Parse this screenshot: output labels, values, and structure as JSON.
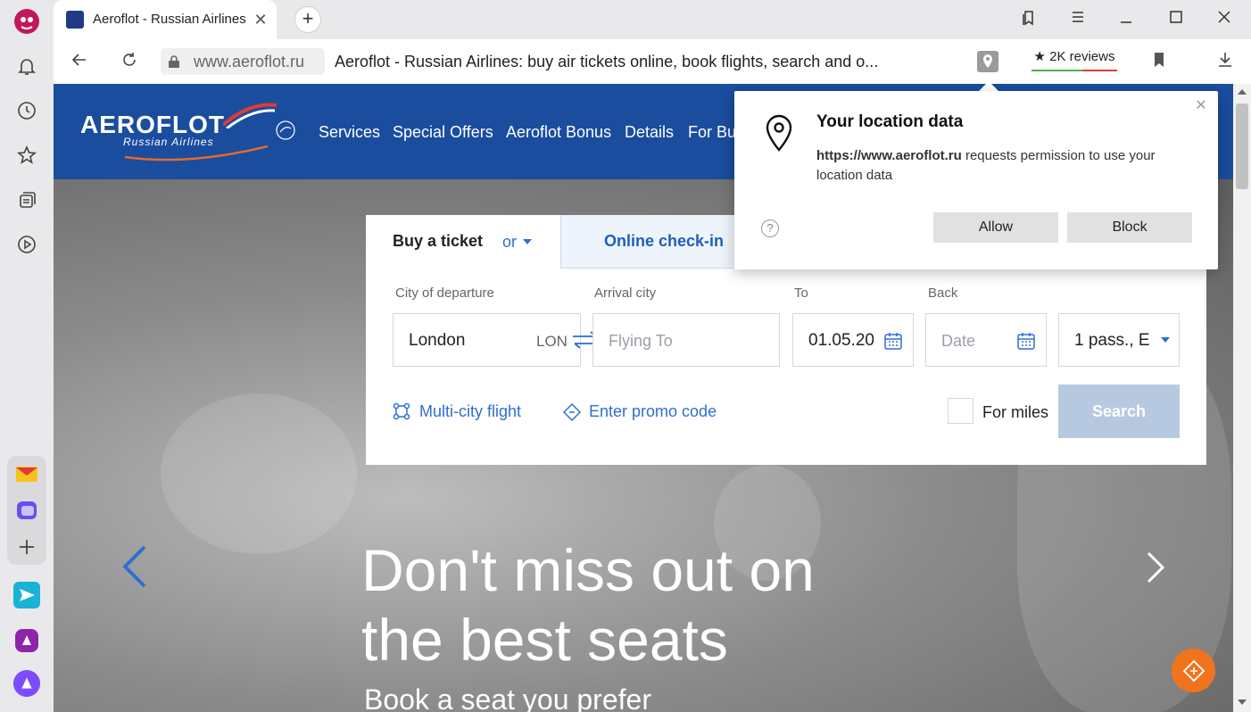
{
  "browser": {
    "tab": {
      "title": "Aeroflot - Russian Airlines",
      "close": "✕"
    },
    "new_tab": "+",
    "window_controls": [
      "bookmark-tabs-icon",
      "menu-icon",
      "minimize-icon",
      "maximize-icon",
      "close-icon"
    ],
    "address": {
      "domain": "www.aeroflot.ru",
      "page_title": "Aeroflot - Russian Airlines: buy air tickets online, book flights, search and o...",
      "reviews": "★ 2K reviews"
    },
    "sidebar_icons": [
      "notifications-icon",
      "history-icon",
      "favorites-icon",
      "collections-icon",
      "video-icon",
      "mail-icon",
      "messenger-icon",
      "add-icon",
      "send-icon",
      "app-icon",
      "alice-icon"
    ]
  },
  "site": {
    "logo": {
      "name": "AEROFLOT",
      "subtitle": "Russian Airlines"
    },
    "nav": [
      "Services",
      "Special Offers",
      "Aeroflot Bonus",
      "Details",
      "For Bu"
    ],
    "booking": {
      "tab_buy": "Buy a ticket",
      "tab_or": "or",
      "tab_checkin": "Online check-in",
      "departure_label": "City of departure",
      "departure_value": "London",
      "departure_code": "LON",
      "arrival_label": "Arrival city",
      "arrival_placeholder": "Flying To",
      "to_label": "To",
      "to_value": "01.05.20",
      "back_label": "Back",
      "back_placeholder": "Date",
      "passengers_value": "1 pass., E",
      "multi_city": "Multi-city flight",
      "promo": "Enter promo code",
      "for_miles": "For miles",
      "search": "Search"
    },
    "hero": {
      "headline_line1": "Don't miss out on",
      "headline_line2": "the best seats",
      "subline": "Book a seat you prefer"
    }
  },
  "popup": {
    "title": "Your location data",
    "site": "https://www.aeroflot.ru",
    "message": " requests permission to use your location data",
    "help": "?",
    "allow": "Allow",
    "block": "Block",
    "close": "✕"
  },
  "colors": {
    "header_blue": "#1a4d9e",
    "link_blue": "#2e6fd0",
    "search_disabled": "#b7c9e0",
    "fab_orange": "#f0741e"
  }
}
